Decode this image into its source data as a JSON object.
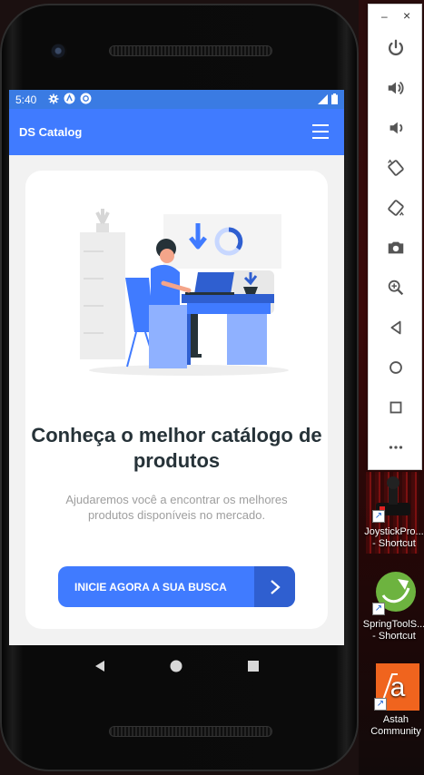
{
  "status_bar": {
    "time": "5:40",
    "icons": [
      "settings-icon",
      "android-icon",
      "sync-icon"
    ],
    "right_icons": [
      "signal-icon",
      "battery-icon"
    ]
  },
  "app_bar": {
    "title": "DS Catalog",
    "menu_icon": "hamburger-menu-icon"
  },
  "home": {
    "headline": "Conheça o melhor catálogo de produtos",
    "subtext": "Ajudaremos você a encontrar os melhores produtos disponíveis no mercado.",
    "cta_label": "INICIE AGORA A SUA BUSCA",
    "cta_icon": "chevron-right-icon"
  },
  "android_nav": [
    "back-icon",
    "home-icon",
    "recents-icon"
  ],
  "emulator_controls": [
    "power-icon",
    "volume-up-icon",
    "volume-down-icon",
    "rotate-left-icon",
    "rotate-right-icon",
    "camera-icon",
    "zoom-icon",
    "back-icon",
    "home-icon",
    "overview-icon",
    "more-icon"
  ],
  "emulator_window": {
    "minimize": "–",
    "close": "×"
  },
  "desktop_shortcuts": [
    {
      "label": "JoystickPro... - Shortcut"
    },
    {
      "label": "SpringToolS... - Shortcut"
    },
    {
      "label": "Astah Community"
    }
  ],
  "colors": {
    "primary": "#407bff",
    "status_bar": "#3a7be3",
    "cta_dark": "#2f5fd0",
    "headline": "#263238",
    "subtext": "#9e9e9e"
  }
}
